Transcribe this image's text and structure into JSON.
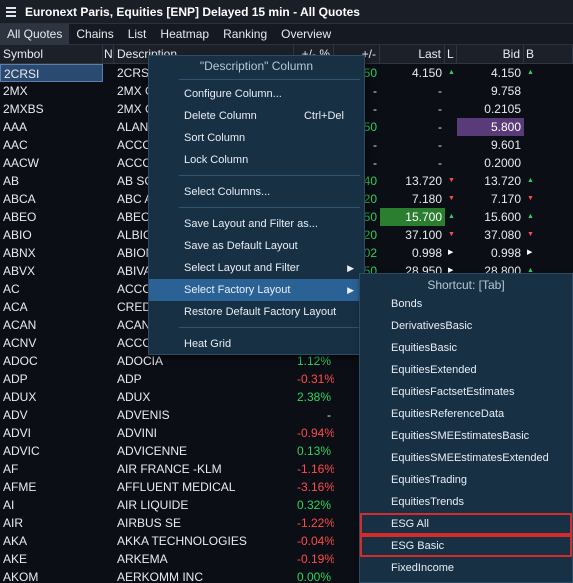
{
  "window": {
    "title": "Euronext Paris, Equities [ENP] Delayed 15 min - All Quotes"
  },
  "tabs": [
    "All Quotes",
    "Chains",
    "List",
    "Heatmap",
    "Ranking",
    "Overview"
  ],
  "columns": {
    "symbol": "Symbol",
    "n": "N",
    "description": "Description",
    "pct_change": "+/- %",
    "change": "+/-",
    "last": "Last",
    "last_flag": "L",
    "bid": "Bid",
    "bid_flag": "B"
  },
  "rows": [
    {
      "symbol": "2CRSI",
      "desc": "2CRSI",
      "pct": "",
      "chg": "50",
      "last": "4.150",
      "lastDir": "up",
      "bid": "4.150",
      "bidDir": "up"
    },
    {
      "symbol": "2MX",
      "desc": "2MX O",
      "pct": "",
      "chg": "-",
      "last": "-",
      "lastDir": "",
      "bid": "9.758",
      "bidDir": ""
    },
    {
      "symbol": "2MXBS",
      "desc": "2MX O",
      "pct": "",
      "chg": "-",
      "last": "-",
      "lastDir": "",
      "bid": "0.2105",
      "bidDir": ""
    },
    {
      "symbol": "AAA",
      "desc": "ALAN A",
      "pct": "",
      "chg": "50",
      "last": "-",
      "lastDir": "",
      "bid": "5.800",
      "bidDir": "",
      "bidHl": "purple"
    },
    {
      "symbol": "AAC",
      "desc": "ACCO",
      "pct": "",
      "chg": "-",
      "last": "-",
      "lastDir": "",
      "bid": "9.601",
      "bidDir": ""
    },
    {
      "symbol": "AACW",
      "desc": "ACCO",
      "pct": "",
      "chg": "-",
      "last": "-",
      "lastDir": "",
      "bid": "0.2000",
      "bidDir": ""
    },
    {
      "symbol": "AB",
      "desc": "AB SC",
      "pct": "",
      "chg": "40",
      "last": "13.720",
      "lastDir": "down",
      "bid": "13.720",
      "bidDir": "up"
    },
    {
      "symbol": "ABCA",
      "desc": "ABC A",
      "pct": "",
      "chg": "20",
      "last": "7.180",
      "lastDir": "down",
      "bid": "7.170",
      "bidDir": "down"
    },
    {
      "symbol": "ABEO",
      "desc": "ABEO",
      "pct": "",
      "chg": "50",
      "last": "15.700",
      "lastDir": "up",
      "lastHl": "green",
      "bid": "15.600",
      "bidDir": "up"
    },
    {
      "symbol": "ABIO",
      "desc": "ALBIO",
      "pct": "",
      "chg": "20",
      "last": "37.100",
      "lastDir": "down",
      "bid": "37.080",
      "bidDir": "down"
    },
    {
      "symbol": "ABNX",
      "desc": "ABION",
      "pct": "",
      "chg": "02",
      "last": "0.998",
      "lastDir": "right",
      "bid": "0.998",
      "bidDir": "right"
    },
    {
      "symbol": "ABVX",
      "desc": "ABIVAX",
      "pct": "",
      "chg": "50",
      "last": "28.950",
      "lastDir": "right",
      "bid": "28.800",
      "bidDir": "up"
    },
    {
      "symbol": "AC",
      "desc": "ACCOR",
      "pct": "",
      "chg": "",
      "last": "",
      "lastDir": "",
      "bid": "",
      "bidDir": ""
    },
    {
      "symbol": "ACA",
      "desc": "CRED",
      "pct": "",
      "chg": "",
      "last": "",
      "lastDir": "",
      "bid": "",
      "bidDir": ""
    },
    {
      "symbol": "ACAN",
      "desc": "ACANT",
      "pct": "",
      "chg": "",
      "last": "",
      "lastDir": "",
      "bid": "",
      "bidDir": ""
    },
    {
      "symbol": "ACNV",
      "desc": "ACCO",
      "pct": "",
      "chg": "",
      "last": "",
      "lastDir": "",
      "bid": "",
      "bidDir": ""
    },
    {
      "symbol": "ADOC",
      "desc": "ADOCIA",
      "pct": "1.12%",
      "chg": "0.",
      "last": "",
      "lastDir": "",
      "bid": "",
      "bidDir": ""
    },
    {
      "symbol": "ADP",
      "desc": "ADP",
      "pct": "-0.31%",
      "chg": "-0.",
      "last": "",
      "lastDir": "",
      "bid": "",
      "bidDir": ""
    },
    {
      "symbol": "ADUX",
      "desc": "ADUX",
      "pct": "2.38%",
      "chg": "0.",
      "last": "",
      "lastDir": "",
      "bid": "",
      "bidDir": ""
    },
    {
      "symbol": "ADV",
      "desc": "ADVENIS",
      "pct": "-",
      "chg": "",
      "last": "",
      "lastDir": "",
      "bid": "",
      "bidDir": ""
    },
    {
      "symbol": "ADVI",
      "desc": "ADVINI",
      "pct": "-0.94%",
      "chg": "-0.",
      "last": "",
      "lastDir": "",
      "bid": "",
      "bidDir": ""
    },
    {
      "symbol": "ADVIC",
      "desc": "ADVICENNE",
      "pct": "0.13%",
      "chg": "0.",
      "last": "",
      "lastDir": "",
      "bid": "",
      "bidDir": ""
    },
    {
      "symbol": "AF",
      "desc": "AIR FRANCE -KLM",
      "pct": "-1.16%",
      "chg": "-0.",
      "last": "",
      "lastDir": "",
      "bid": "",
      "bidDir": ""
    },
    {
      "symbol": "AFME",
      "desc": "AFFLUENT MEDICAL",
      "pct": "-3.16%",
      "chg": "-0.",
      "last": "",
      "lastDir": "",
      "bid": "",
      "bidDir": ""
    },
    {
      "symbol": "AI",
      "desc": "AIR LIQUIDE",
      "pct": "0.32%",
      "chg": "0.",
      "last": "",
      "lastDir": "",
      "bid": "",
      "bidDir": ""
    },
    {
      "symbol": "AIR",
      "desc": "AIRBUS SE",
      "pct": "-1.22%",
      "chg": "-1.",
      "last": "",
      "lastDir": "",
      "bid": "",
      "bidDir": ""
    },
    {
      "symbol": "AKA",
      "desc": "AKKA TECHNOLOGIES",
      "pct": "-0.04%",
      "chg": "-0.",
      "last": "",
      "lastDir": "",
      "bid": "",
      "bidDir": ""
    },
    {
      "symbol": "AKE",
      "desc": "ARKEMA",
      "pct": "-0.19%",
      "chg": "-0.",
      "last": "",
      "lastDir": "",
      "bid": "",
      "bidDir": ""
    },
    {
      "symbol": "AKOM",
      "desc": "AERKOMM INC",
      "pct": "0.00%",
      "chg": "0.",
      "last": "",
      "lastDir": "",
      "bid": "",
      "bidDir": ""
    }
  ],
  "context_menu": {
    "header": "\"Description\" Column",
    "configure_column": "Configure Column...",
    "delete_column": "Delete Column",
    "delete_shortcut": "Ctrl+Del",
    "sort_column": "Sort Column",
    "lock_column": "Lock Column",
    "select_columns": "Select Columns...",
    "save_layout_filter": "Save Layout and Filter as...",
    "save_default_layout": "Save as Default Layout",
    "select_layout_filter": "Select Layout and Filter",
    "select_factory_layout": "Select Factory Layout",
    "restore_default_factory": "Restore Default Factory Layout",
    "heat_grid": "Heat Grid"
  },
  "submenu": {
    "header": "Shortcut: [Tab]",
    "items": [
      "Bonds",
      "DerivativesBasic",
      "EquitiesBasic",
      "EquitiesExtended",
      "EquitiesFactsetEstimates",
      "EquitiesReferenceData",
      "EquitiesSMEEstimatesBasic",
      "EquitiesSMEEstimatesExtended",
      "EquitiesTrading",
      "EquitiesTrends",
      "ESG All",
      "ESG Basic",
      "FixedIncome"
    ],
    "highlighted": [
      "ESG All",
      "ESG Basic"
    ]
  },
  "colors": {
    "positive": "#2dd35f",
    "negative": "#ff4a4a",
    "highlight_box": "#d62b2b",
    "menu_active": "#2a6295"
  }
}
